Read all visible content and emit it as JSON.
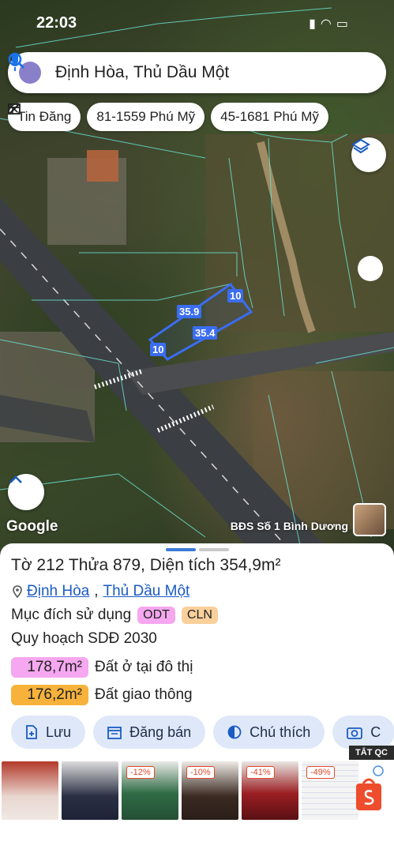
{
  "status": {
    "time": "22:03"
  },
  "search": {
    "text": "Định Hòa, Thủ Dầu Một"
  },
  "chips": [
    {
      "label": "Tin Đăng"
    },
    {
      "label": "81-1559 Phú Mỹ"
    },
    {
      "label": "45-1681 Phú Mỹ"
    }
  ],
  "map": {
    "google_label": "Google",
    "provider_label": "BĐS Số 1 Bình Dương",
    "plot_labels": {
      "top": "35.9",
      "bottom": "35.4",
      "right": "10",
      "left": "10"
    }
  },
  "sheet": {
    "title": "Tờ 212 Thửa 879, Diện tích 354,9m²",
    "location_part1": "Định Hòa",
    "location_sep": ",",
    "location_part2": "Thủ Dầu Một",
    "purpose_label": "Mục đích sử dụng",
    "purpose_tags": [
      "ODT",
      "CLN"
    ],
    "planning_label": "Quy hoạch SDĐ 2030",
    "areas": [
      {
        "value": "178,7m²",
        "desc": "Đất ở tại đô thị",
        "color": "#f5a7ef"
      },
      {
        "value": "176,2m²",
        "desc": "Đất giao thông",
        "color": "#f7b23c"
      }
    ],
    "actions": [
      {
        "label": "Lưu"
      },
      {
        "label": "Đăng bán"
      },
      {
        "label": "Chú thích"
      },
      {
        "label": "C"
      }
    ]
  },
  "ad": {
    "close_label": "TẮT QC",
    "discounts": [
      "-12%",
      "-10%",
      "-41%",
      "-49%"
    ]
  },
  "colors": {
    "accent": "#1a5bc4",
    "plot": "#3a6df0",
    "handle_active": "#3a7bd5",
    "handle_inactive": "#c9c9c9"
  }
}
